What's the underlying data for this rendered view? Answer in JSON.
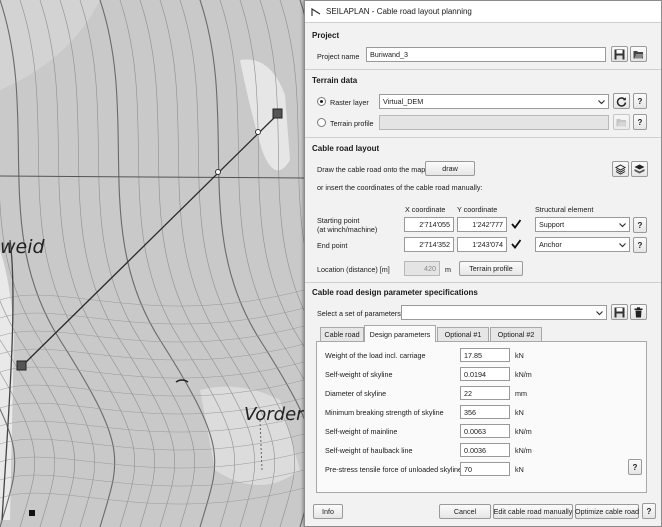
{
  "map": {
    "place_label_left": "weid",
    "place_label_right": "Vorderv"
  },
  "window": {
    "title": "SEILAPLAN - Cable road layout planning"
  },
  "project": {
    "section_title": "Project",
    "name_label": "Project name",
    "name_value": "Buriwand_3"
  },
  "terrain": {
    "section_title": "Terrain data",
    "raster_label": "Raster layer",
    "raster_value": "Virtual_DEM",
    "profile_label": "Terrain profile",
    "profile_value": "",
    "selected": "raster"
  },
  "layout": {
    "section_title": "Cable road layout",
    "draw_text": "Draw the cable road onto the map",
    "draw_button": "draw",
    "insert_text": "or insert the coordinates of the cable road manually:",
    "x_header": "X coordinate",
    "y_header": "Y coordinate",
    "struct_header": "Structural element",
    "start_label_1": "Starting point",
    "start_label_2": "(at winch/machine)",
    "start_x": "2'714'055",
    "start_y": "1'242'777",
    "start_struct": "Support",
    "end_label": "End point",
    "end_x": "2'714'352",
    "end_y": "1'243'074",
    "end_struct": "Anchor",
    "distance_label": "Location (distance) [m]",
    "distance_value": "420",
    "distance_unit": "m",
    "profile_button": "Terrain profile"
  },
  "params": {
    "section_title": "Cable road design parameter specifications",
    "select_label": "Select a set of parameters",
    "select_value": "",
    "tabs": [
      {
        "label": "Cable road"
      },
      {
        "label": "Design parameters"
      },
      {
        "label": "Optional #1"
      },
      {
        "label": "Optional #2"
      }
    ],
    "active_tab": "Design parameters",
    "rows": [
      {
        "label": "Weight of the load incl. carriage",
        "value": "17.85",
        "unit": "kN"
      },
      {
        "label": "Self-weight of skyline",
        "value": "0.0194",
        "unit": "kN/m"
      },
      {
        "label": "Diameter of skyline",
        "value": "22",
        "unit": "mm"
      },
      {
        "label": "Minimum breaking strength of skyline",
        "value": "356",
        "unit": "kN"
      },
      {
        "label": "Self-weight of mainline",
        "value": "0.0063",
        "unit": "kN/m"
      },
      {
        "label": "Self-weight of haulback line",
        "value": "0.0036",
        "unit": "kN/m"
      },
      {
        "label": "Pre-stress tensile force of unloaded skyline",
        "value": "70",
        "unit": "kN"
      }
    ],
    "help_label": "?"
  },
  "footer": {
    "info": "Info",
    "cancel": "Cancel",
    "edit": "Edit cable road manually",
    "optimize": "Optimize cable road",
    "help": "?"
  },
  "help_glyph": "?"
}
